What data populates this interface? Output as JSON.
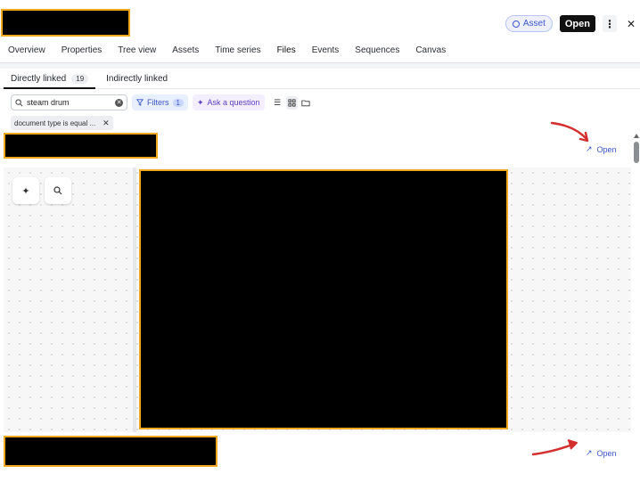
{
  "header": {
    "asset_label": "Asset",
    "open_label": "Open",
    "more_icon": "more-vertical-icon",
    "close_icon": "close-icon"
  },
  "tabs": [
    {
      "label": "Overview"
    },
    {
      "label": "Properties"
    },
    {
      "label": "Tree view"
    },
    {
      "label": "Assets"
    },
    {
      "label": "Time series"
    },
    {
      "label": "Files",
      "active": true
    },
    {
      "label": "Events"
    },
    {
      "label": "Sequences"
    },
    {
      "label": "Canvas"
    }
  ],
  "subtabs": {
    "directly_linked": "Directly linked",
    "directly_linked_count": "19",
    "indirectly_linked": "Indirectly linked"
  },
  "toolbar": {
    "search_value": "steam drum",
    "filters_label": "Filters",
    "filters_count": "1",
    "ask_label": "Ask a question"
  },
  "filter_chip": {
    "label": "document type is equal ..."
  },
  "files": [
    {
      "open_label": "Open"
    },
    {
      "open_label": "Open"
    }
  ],
  "colors": {
    "accent": "#3b56c9",
    "redaction": "#000000",
    "redaction_border": "#f0a81e",
    "annotation_arrow": "#d32f2f"
  }
}
